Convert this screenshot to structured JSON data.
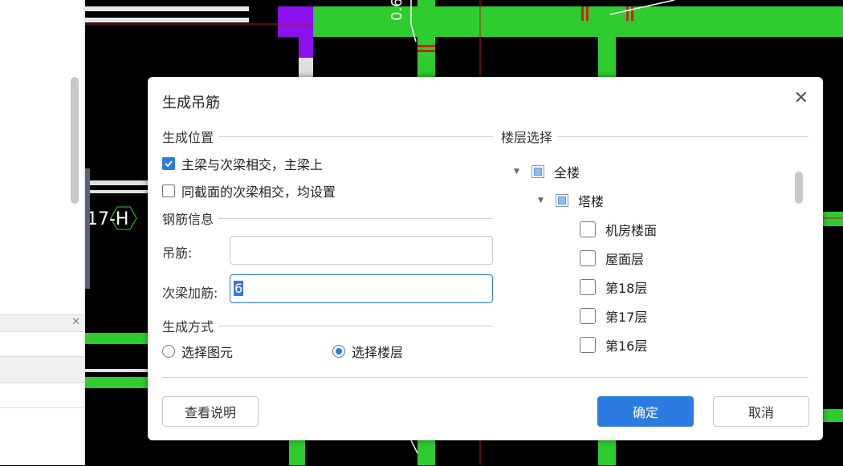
{
  "cad": {
    "label_axis": "17-H",
    "label_dim": "0.6"
  },
  "dialog": {
    "title": "生成吊筋",
    "close_symbol": "✕",
    "position_section": {
      "label": "生成位置",
      "options": [
        {
          "label": "主梁与次梁相交，主梁上",
          "checked": true
        },
        {
          "label": "同截面的次梁相交，均设置",
          "checked": false
        }
      ]
    },
    "rebar_section": {
      "label": "钢筋信息",
      "hanger_label": "吊筋:",
      "hanger_value": "",
      "secondary_label": "次梁加筋:",
      "secondary_value": "6"
    },
    "method_section": {
      "label": "生成方式",
      "options": [
        {
          "label": "选择图元",
          "selected": false
        },
        {
          "label": "选择楼层",
          "selected": true
        }
      ]
    },
    "floor_section": {
      "label": "楼层选择",
      "tree": [
        {
          "label": "全楼",
          "level": 0,
          "expanded": true,
          "state": "partial"
        },
        {
          "label": "塔楼",
          "level": 1,
          "expanded": true,
          "state": "partial"
        },
        {
          "label": "机房楼面",
          "level": 2,
          "state": "unchecked"
        },
        {
          "label": "屋面层",
          "level": 2,
          "state": "unchecked"
        },
        {
          "label": "第18层",
          "level": 2,
          "state": "unchecked"
        },
        {
          "label": "第17层",
          "level": 2,
          "state": "unchecked"
        },
        {
          "label": "第16层",
          "level": 2,
          "state": "unchecked"
        }
      ]
    },
    "buttons": {
      "help": "查看说明",
      "ok": "确定",
      "cancel": "取消"
    }
  },
  "left_panel": {
    "close_symbol": "✕"
  }
}
